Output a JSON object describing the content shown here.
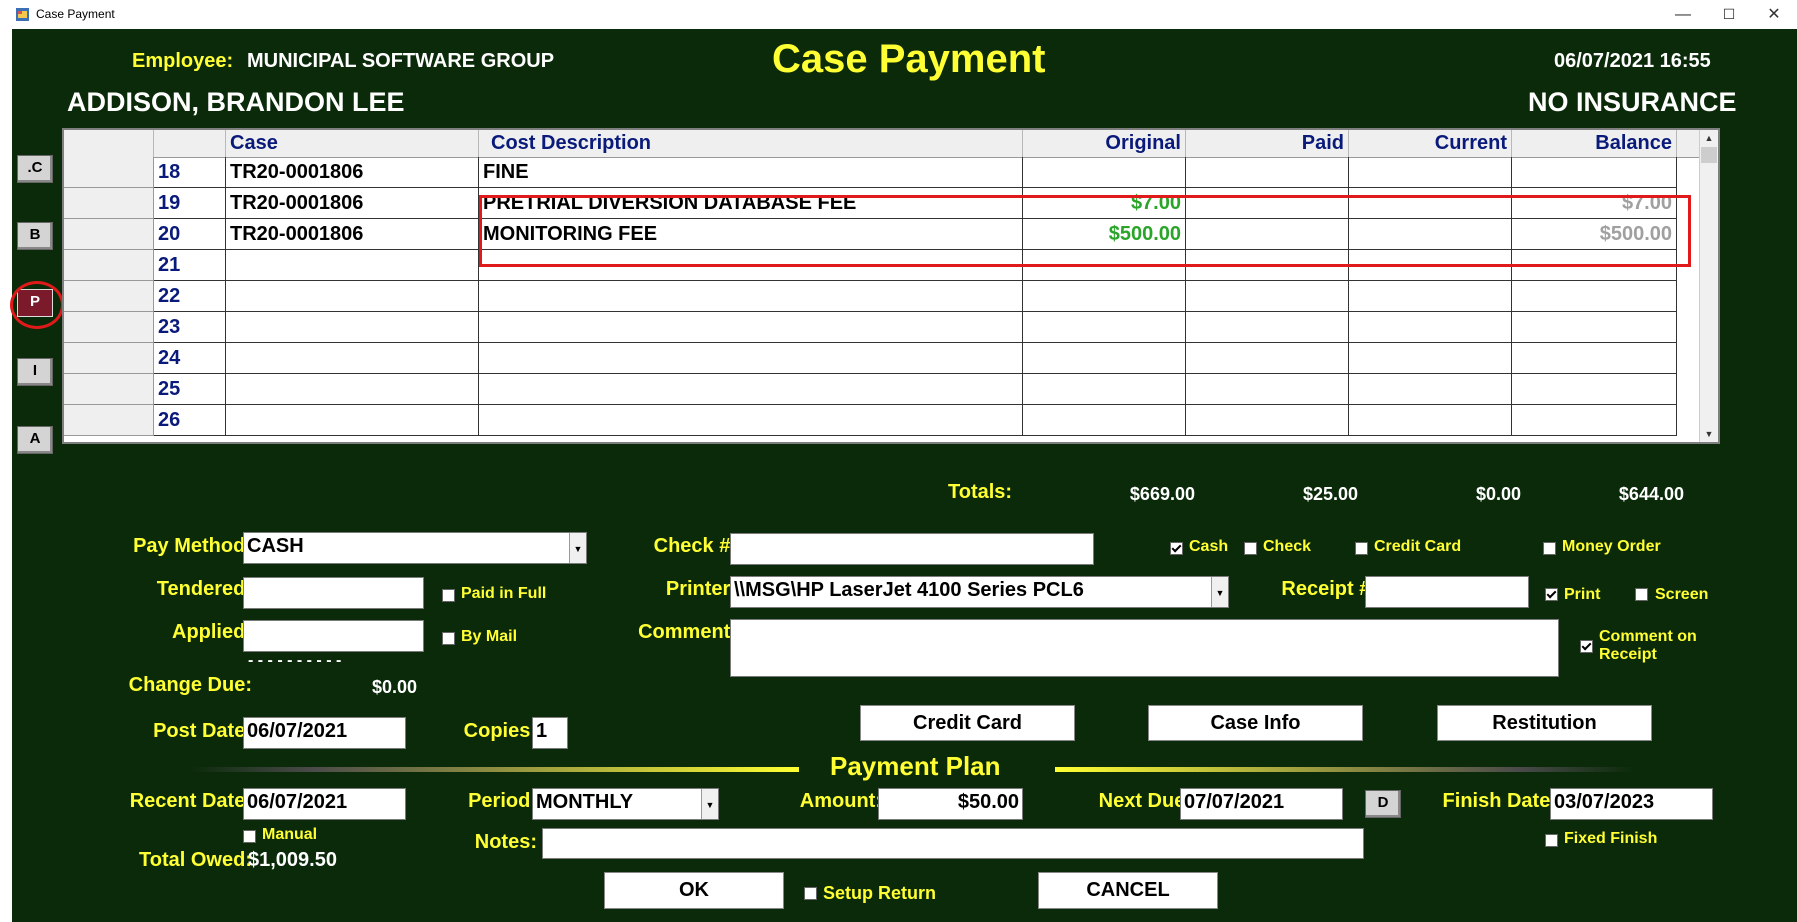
{
  "window": {
    "title": "Case Payment",
    "minimize": "—",
    "maximize": "☐",
    "close": "✕"
  },
  "header": {
    "employee_label": "Employee:",
    "employee_name": "MUNICIPAL SOFTWARE GROUP",
    "page_title": "Case Payment",
    "datetime": "06/07/2021 16:55",
    "defendant": "ADDISON, BRANDON LEE",
    "insurance": "NO INSURANCE"
  },
  "side_buttons": [
    ".C",
    "B",
    "P",
    "I",
    "A"
  ],
  "grid": {
    "columns": [
      "Case",
      "Cost Description",
      "Original",
      "Paid",
      "Current",
      "Balance"
    ],
    "rows": [
      {
        "num": "18",
        "case": "TR20-0001806",
        "desc": "FINE",
        "original": "",
        "paid": "",
        "current": "",
        "balance": ""
      },
      {
        "num": "19",
        "case": "TR20-0001806",
        "desc": "PRETRIAL DIVERSION DATABASE FEE",
        "original": "$7.00",
        "paid": "",
        "current": "",
        "balance": "$7.00"
      },
      {
        "num": "20",
        "case": "TR20-0001806",
        "desc": "MONITORING FEE",
        "original": "$500.00",
        "paid": "",
        "current": "",
        "balance": "$500.00"
      },
      {
        "num": "21",
        "case": "",
        "desc": "",
        "original": "",
        "paid": "",
        "current": "",
        "balance": ""
      },
      {
        "num": "22",
        "case": "",
        "desc": "",
        "original": "",
        "paid": "",
        "current": "",
        "balance": ""
      },
      {
        "num": "23",
        "case": "",
        "desc": "",
        "original": "",
        "paid": "",
        "current": "",
        "balance": ""
      },
      {
        "num": "24",
        "case": "",
        "desc": "",
        "original": "",
        "paid": "",
        "current": "",
        "balance": ""
      },
      {
        "num": "25",
        "case": "",
        "desc": "",
        "original": "",
        "paid": "",
        "current": "",
        "balance": ""
      },
      {
        "num": "26",
        "case": "",
        "desc": "",
        "original": "",
        "paid": "",
        "current": "",
        "balance": ""
      }
    ]
  },
  "totals": {
    "label": "Totals:",
    "original": "$669.00",
    "paid": "$25.00",
    "current": "$0.00",
    "balance": "$644.00"
  },
  "payment": {
    "pay_method_label": "Pay Method:",
    "pay_method_value": "CASH",
    "tendered_label": "Tendered:",
    "tendered_value": "",
    "applied_label": "Applied:",
    "applied_value": "",
    "paid_in_full_label": "Paid in Full",
    "by_mail_label": "By Mail",
    "dashes": "- - - - - - - - - -",
    "change_due_label": "Change Due:",
    "change_due_value": "$0.00",
    "post_date_label": "Post Date:",
    "post_date_value": "06/07/2021",
    "copies_label": "Copies:",
    "copies_value": "1",
    "check_label": "Check #:",
    "check_value": "",
    "printer_label": "Printer:",
    "printer_value": "\\\\MSG\\HP LaserJet 4100 Series PCL6",
    "comment_label": "Comment:",
    "comment_value": "",
    "receipt_label": "Receipt #:",
    "receipt_value": "",
    "types": [
      {
        "label": "Cash",
        "checked": true
      },
      {
        "label": "Check",
        "checked": false
      },
      {
        "label": "Credit Card",
        "checked": false
      },
      {
        "label": "Money Order",
        "checked": false
      }
    ],
    "print_label": "Print",
    "screen_label": "Screen",
    "comment_on_receipt_label": "Comment on\nReceipt"
  },
  "buttons": {
    "credit_card": "Credit Card",
    "case_info": "Case Info",
    "restitution": "Restitution",
    "ok": "OK",
    "cancel": "CANCEL",
    "d": "D"
  },
  "plan": {
    "title": "Payment Plan",
    "recent_date_label": "Recent Date:",
    "recent_date_value": "06/07/2021",
    "manual_label": "Manual",
    "total_owed_label": "Total Owed:",
    "total_owed_value": "$1,009.50",
    "period_label": "Period:",
    "period_value": "MONTHLY",
    "notes_label": "Notes:",
    "notes_value": "",
    "amount_label": "Amount:",
    "amount_value": "$50.00",
    "next_due_label": "Next Due:",
    "next_due_value": "07/07/2021",
    "finish_date_label": "Finish Date:",
    "finish_date_value": "03/07/2023",
    "fixed_finish_label": "Fixed Finish",
    "setup_return_label": "Setup Return"
  }
}
